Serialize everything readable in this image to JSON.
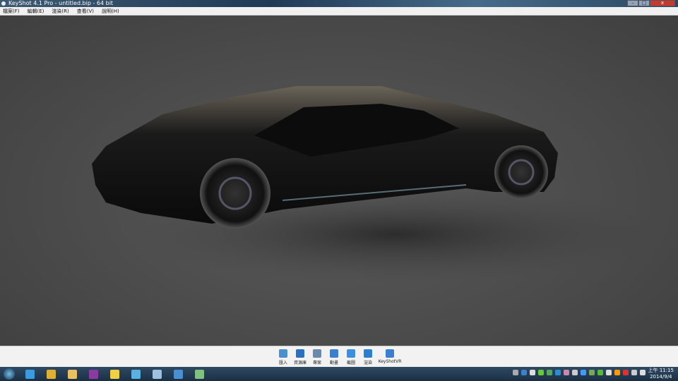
{
  "window": {
    "title": "KeyShot 4.1 Pro  - untitled.bip  - 64 bit",
    "minimize": "–",
    "maximize": "□",
    "close": "x"
  },
  "menu": [
    "檔案(F)",
    "編輯(E)",
    "渲染(R)",
    "查看(V)",
    "說明(H)"
  ],
  "ribbon": [
    {
      "label": "匯入",
      "icon": "import-icon",
      "color": "#4a8fd0"
    },
    {
      "label": "資源庫",
      "icon": "library-icon",
      "color": "#2a6fc0"
    },
    {
      "label": "專案",
      "icon": "project-icon",
      "color": "#6a8aaa"
    },
    {
      "label": "動畫",
      "icon": "animation-icon",
      "color": "#3a7fd0"
    },
    {
      "label": "截圖",
      "icon": "screenshot-icon",
      "color": "#3a8fe0"
    },
    {
      "label": "渲染",
      "icon": "render-icon",
      "color": "#2a7fd0"
    },
    {
      "label": "KeyShotVR",
      "icon": "keyshotvr-icon",
      "color": "#3a7fd0"
    }
  ],
  "taskbar": {
    "apps": [
      {
        "name": "internet-explorer",
        "color": "#3a9be0"
      },
      {
        "name": "chrome",
        "color": "#e0b030"
      },
      {
        "name": "file-explorer",
        "color": "#e8c060"
      },
      {
        "name": "onenote",
        "color": "#8a3aa0"
      },
      {
        "name": "app-grid",
        "color": "#f0d040"
      },
      {
        "name": "app-blue",
        "color": "#5ab0e0"
      },
      {
        "name": "notepad",
        "color": "#a0c0e0"
      },
      {
        "name": "keyshot",
        "color": "#4a90d0"
      },
      {
        "name": "image-viewer",
        "color": "#80c080"
      }
    ],
    "tray_colors": [
      "#aaa",
      "#3a7fd0",
      "#ddd",
      "#6c3",
      "#5a5",
      "#2a8fd0",
      "#c8a",
      "#ccc",
      "#49f",
      "#7a5",
      "#5b3",
      "#ddd",
      "#f90",
      "#d33",
      "#ccc",
      "#ddd"
    ],
    "time": "上午 11:15",
    "date": "2014/9/4"
  }
}
